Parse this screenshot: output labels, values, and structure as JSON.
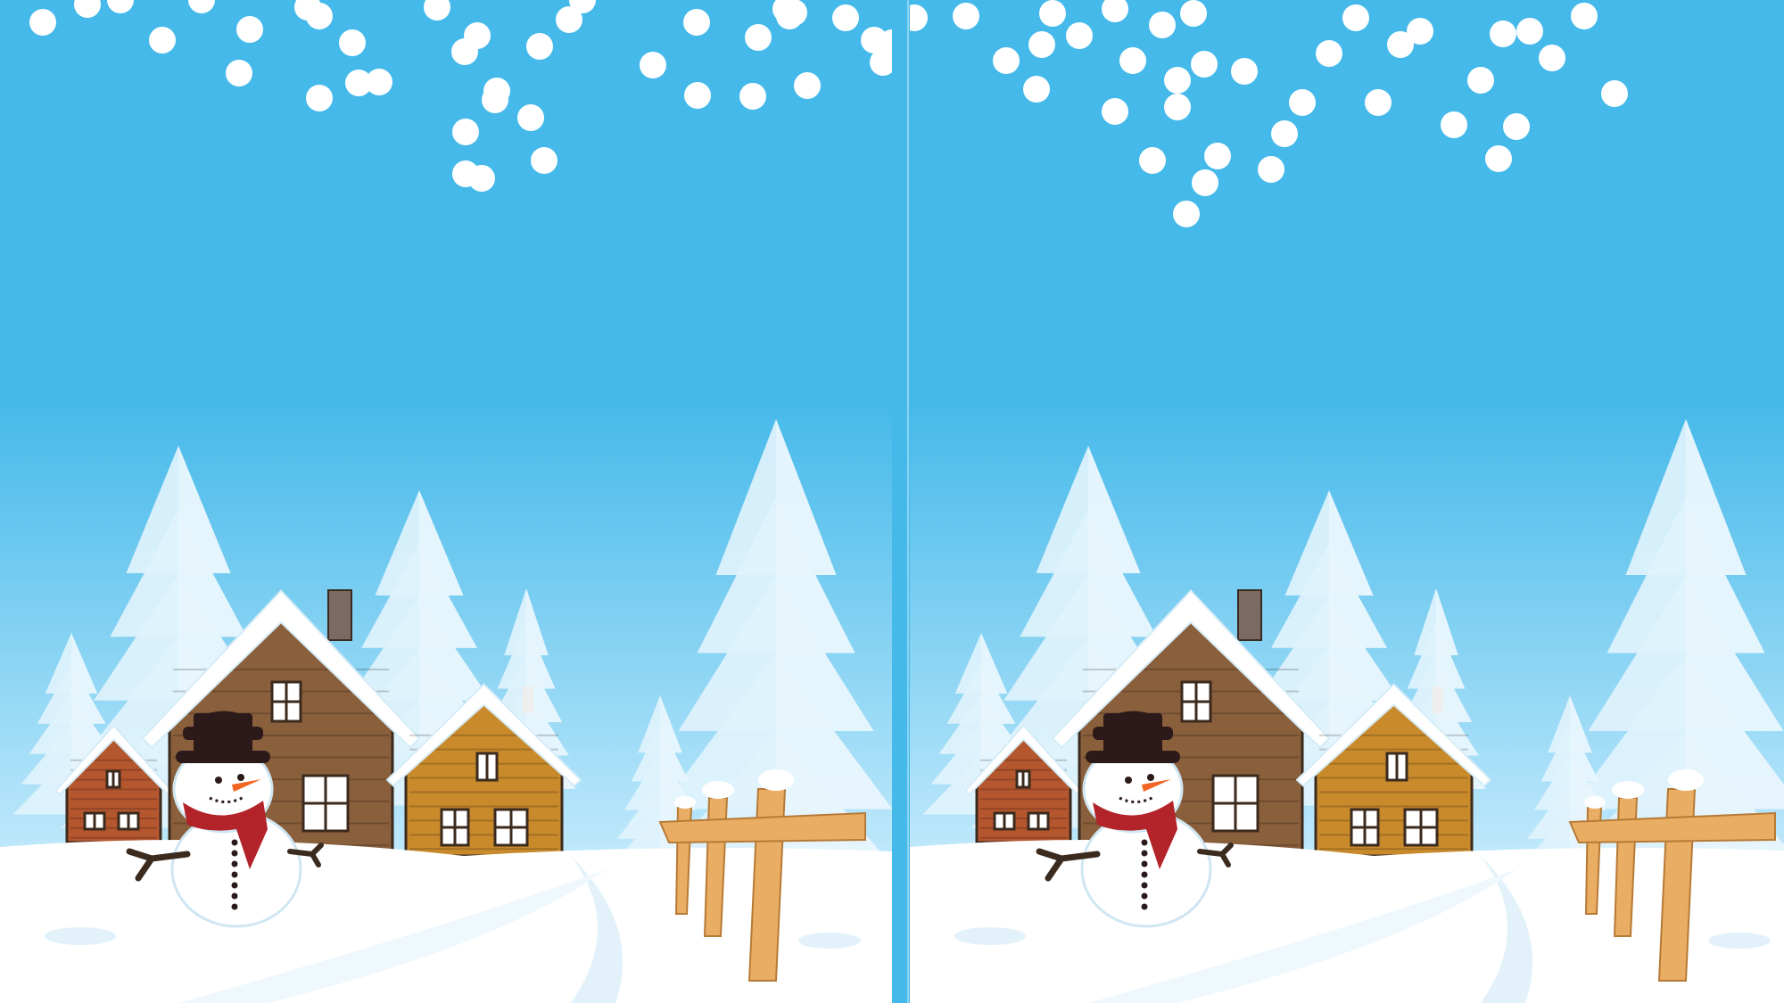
{
  "game": {
    "type": "spot-the-difference",
    "panels": [
      {
        "id": "left",
        "label": ""
      },
      {
        "id": "right",
        "label": ""
      }
    ]
  },
  "colors": {
    "sky_top": "#45b9ea",
    "sky_bottom": "#bfe8fb",
    "snow": "#ffffff",
    "tree": "#dff3fc",
    "cabin_brown": "#8a5f3c",
    "cabin_orange": "#c98a2c",
    "cabin_red": "#b5572e",
    "fence": "#e9ad63",
    "scarf": "#b3232a",
    "hat": "#2b1a19",
    "carrot": "#f26522"
  },
  "scene": {
    "elements": [
      "snowflakes",
      "pine-trees",
      "cabins",
      "snowman",
      "fence",
      "snowy-ground"
    ]
  }
}
